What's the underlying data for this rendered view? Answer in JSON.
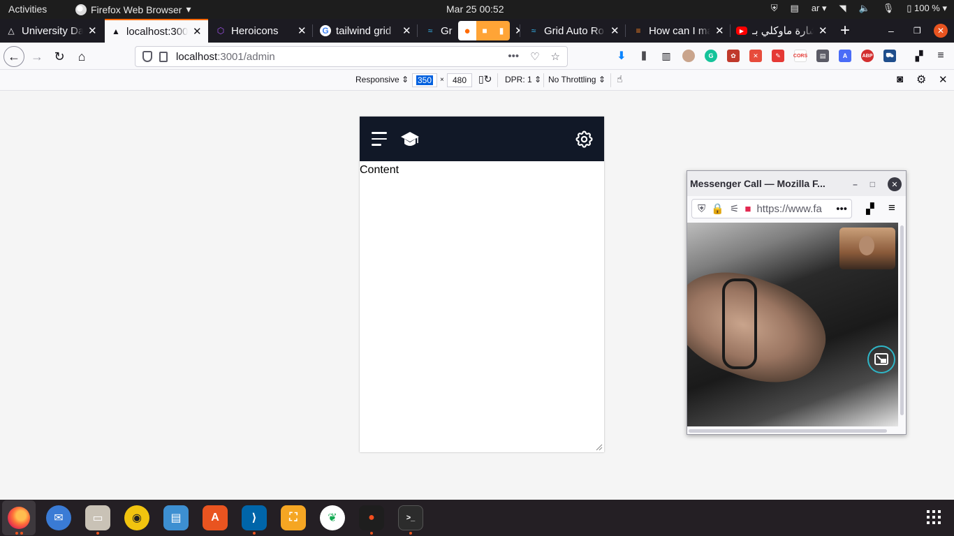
{
  "system": {
    "activities": "Activities",
    "app_name": "Firefox Web Browser",
    "clock": "Mar 25  00:52",
    "lang": "ar",
    "battery": "100 %"
  },
  "tabs": [
    {
      "label": "University Da",
      "favicon": "triangle-icon"
    },
    {
      "label": "localhost:300",
      "favicon": "triangle-icon",
      "active": true
    },
    {
      "label": "Heroicons",
      "favicon": "heroicons-icon"
    },
    {
      "label": "tailwind grid",
      "favicon": "google-icon"
    },
    {
      "label": "Gr",
      "favicon": "tailwind-icon"
    },
    {
      "label": "Grid Auto Ro",
      "favicon": "tailwind-icon"
    },
    {
      "label": "How can I ma",
      "favicon": "stackoverflow-icon"
    },
    {
      "label": "شارة ماوكلي بـ",
      "favicon": "youtube-icon"
    }
  ],
  "navbar": {
    "url_host": "localhost",
    "url_path": ":3001/admin"
  },
  "rdm": {
    "device": "Responsive",
    "width": "350",
    "times": "×",
    "height": "480",
    "dpr": "DPR: 1",
    "throttling": "No Throttling"
  },
  "page": {
    "content_text": "Content"
  },
  "messenger": {
    "title": "Messenger Call — Mozilla F...",
    "url": "https://www.fa"
  },
  "colors": {
    "app_nav_bg": "#111827",
    "tab_active_accent": "#ff6a00",
    "ubuntu_orange": "#e95420"
  }
}
